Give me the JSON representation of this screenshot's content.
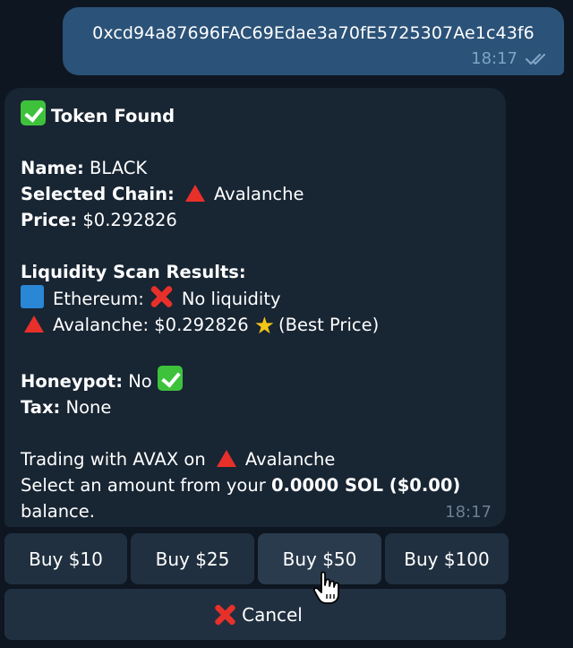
{
  "outgoing": {
    "text": "0xcd94a87696FAC69Edae3a70fE5725307Ae1c43f6",
    "time": "18:17"
  },
  "incoming": {
    "header": "Token Found",
    "name_label": "Name:",
    "name_value": "BLACK",
    "chain_label": "Selected Chain:",
    "chain_value": "Avalanche",
    "price_label": "Price:",
    "price_value": "$0.292826",
    "scan_title": "Liquidity Scan Results:",
    "scan_eth_label": "Ethereum:",
    "scan_eth_value": "No liquidity",
    "scan_avax_label": "Avalanche: $0.292826",
    "scan_avax_note": "(Best Price)",
    "honeypot_label": "Honeypot:",
    "honeypot_value": "No",
    "tax_label": "Tax:",
    "tax_value": "None",
    "trading_prefix": "Trading with AVAX on",
    "trading_chain": "Avalanche",
    "select_prefix": "Select an amount from your",
    "balance": "0.0000 SOL ($0.00)",
    "select_suffix": "balance.",
    "time": "18:17"
  },
  "keyboard": {
    "row1": [
      "Buy $10",
      "Buy $25",
      "Buy $50",
      "Buy $100"
    ],
    "cancel": "Cancel"
  },
  "colors": {
    "background": "#0e1621",
    "outgoing_bubble": "#2b5278",
    "incoming_bubble": "#182533",
    "button": "#213040"
  },
  "icons": [
    "double-check-icon",
    "check-box-icon",
    "red-triangle-icon",
    "blue-square-icon",
    "cross-icon",
    "star-icon",
    "hand-cursor-icon"
  ]
}
